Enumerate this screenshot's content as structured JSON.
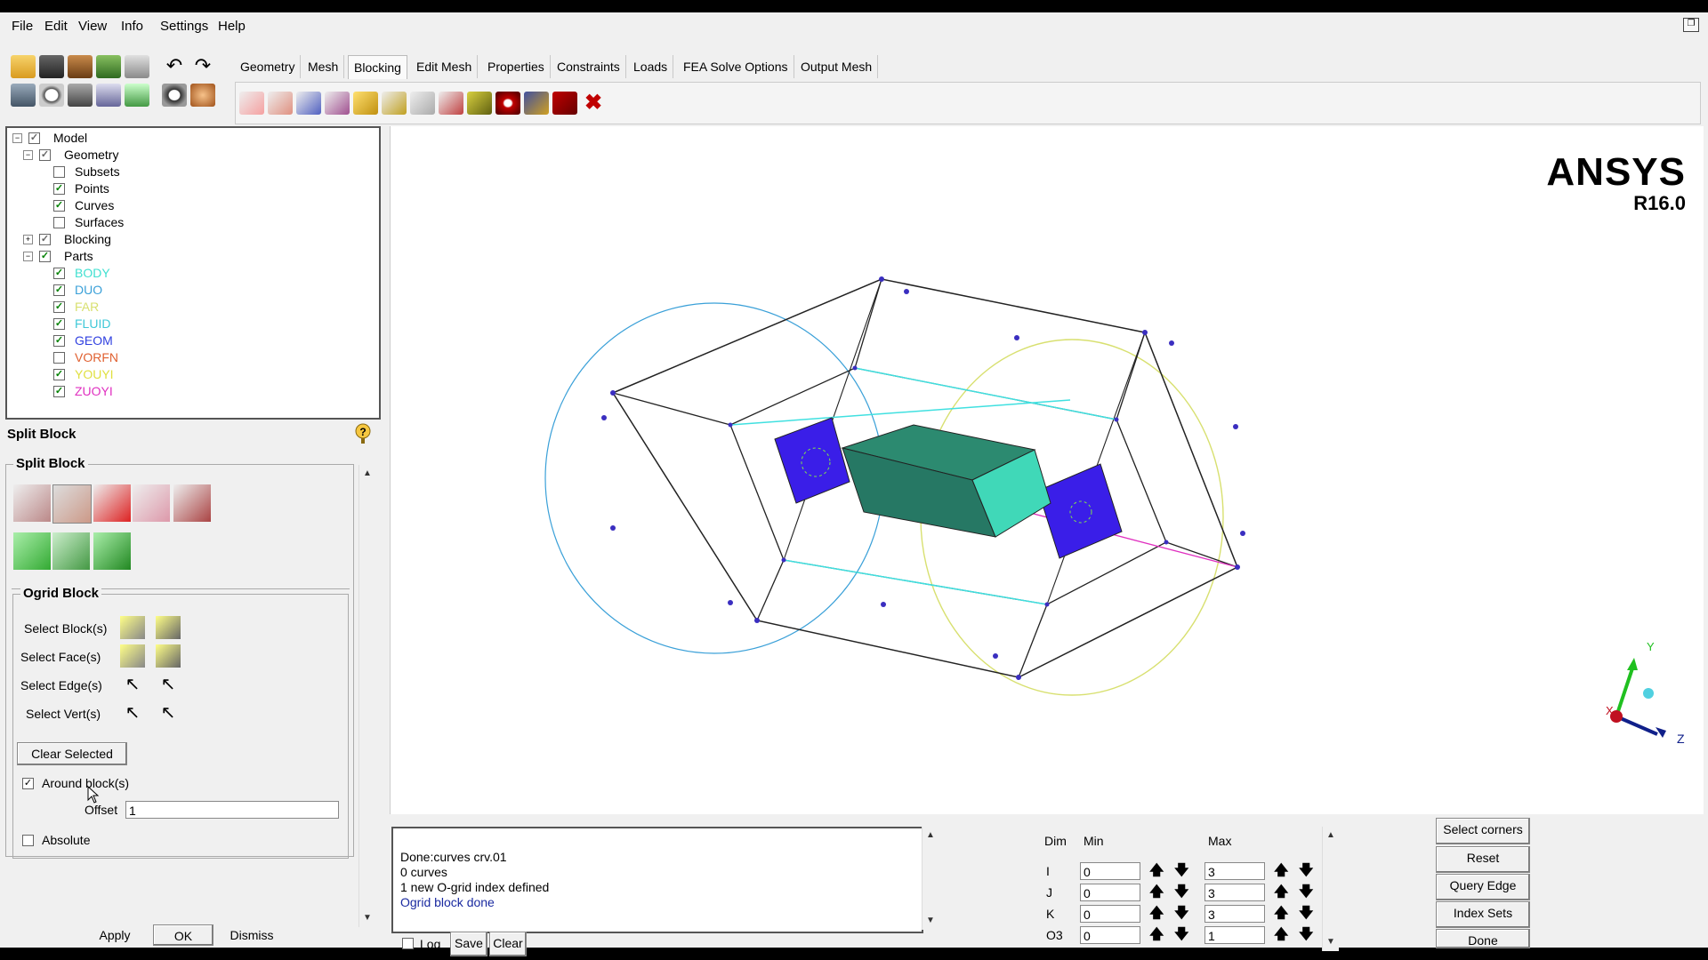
{
  "menu": [
    "File",
    "Edit",
    "View",
    "Info",
    "Settings",
    "Help"
  ],
  "tabs": [
    "Geometry",
    "Mesh",
    "Blocking",
    "Edit Mesh",
    "Properties",
    "Constraints",
    "Loads",
    "FEA Solve Options",
    "Output Mesh"
  ],
  "active_tab": "Blocking",
  "tree": {
    "model": "Model",
    "geometry": "Geometry",
    "subsets": "Subsets",
    "points": "Points",
    "curves": "Curves",
    "surfaces": "Surfaces",
    "blocking": "Blocking",
    "parts_label": "Parts",
    "parts": [
      {
        "name": "BODY",
        "color": "#40e0d0",
        "checked": true
      },
      {
        "name": "DUO",
        "color": "#3aa0d8",
        "checked": true
      },
      {
        "name": "FAR",
        "color": "#d8e070",
        "checked": true
      },
      {
        "name": "FLUID",
        "color": "#40c8d8",
        "checked": true
      },
      {
        "name": "GEOM",
        "color": "#3040e0",
        "checked": true
      },
      {
        "name": "VORFN",
        "color": "#e06030",
        "checked": false
      },
      {
        "name": "YOUYI",
        "color": "#e0e040",
        "checked": true
      },
      {
        "name": "ZUOYI",
        "color": "#e030c0",
        "checked": true
      }
    ]
  },
  "panel": {
    "title": "Split Block",
    "group_title": "Split Block",
    "ogrid_title": "Ogrid Block",
    "select_blocks": "Select Block(s)",
    "select_faces": "Select Face(s)",
    "select_edges": "Select Edge(s)",
    "select_verts": "Select Vert(s)",
    "clear_selected": "Clear Selected",
    "around_blocks": "Around block(s)",
    "offset_label": "Offset",
    "offset_value": "1",
    "absolute_label": "Absolute",
    "apply": "Apply",
    "ok": "OK",
    "dismiss": "Dismiss"
  },
  "logo": {
    "brand": "ANSYS",
    "version": "R16.0"
  },
  "axes": {
    "x": "X",
    "y": "Y",
    "z": "Z"
  },
  "console": {
    "lines": [
      "Done:curves crv.01",
      "0 curves",
      "1 new O-grid index defined",
      "Ogrid block done"
    ],
    "log": "Log",
    "save": "Save",
    "clear": "Clear"
  },
  "dims": {
    "header_dim": "Dim",
    "header_min": "Min",
    "header_max": "Max",
    "rows": [
      {
        "dim": "I",
        "min": "0",
        "max": "3"
      },
      {
        "dim": "J",
        "min": "0",
        "max": "3"
      },
      {
        "dim": "K",
        "min": "0",
        "max": "3"
      },
      {
        "dim": "O3",
        "min": "0",
        "max": "1"
      }
    ]
  },
  "right_buttons": [
    "Select corners",
    "Reset",
    "Query Edge",
    "Index Sets",
    "Done"
  ]
}
